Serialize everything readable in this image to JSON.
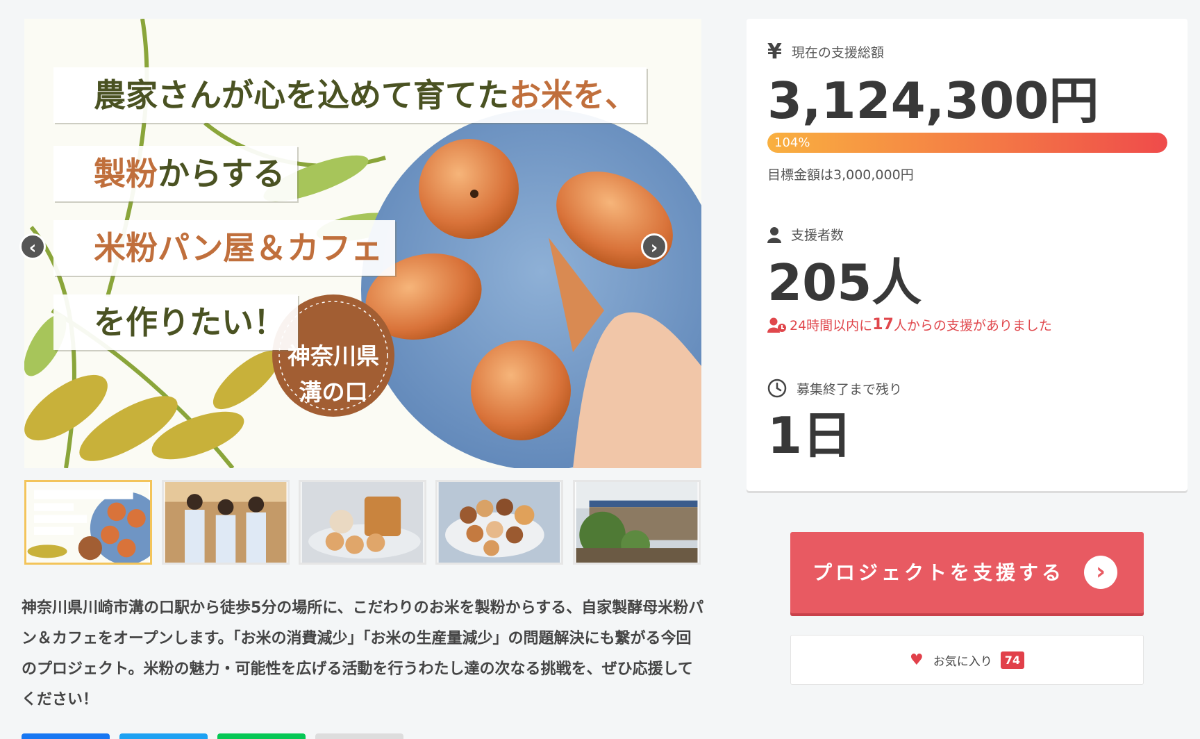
{
  "hero": {
    "line1_a": "農家さんが心を込めて育てた",
    "line1_b": "お米を、",
    "line2_a": "製粉",
    "line2_b": "からする",
    "line3": "米粉パン屋＆カフェ",
    "line4": "を作りたい！",
    "badge_line1": "神奈川県",
    "badge_line2": "溝の口",
    "prev_icon": "‹",
    "next_icon": "›"
  },
  "thumbnails": [
    {
      "name": "bread-plate-banner",
      "active": true
    },
    {
      "name": "staff-photo",
      "active": false
    },
    {
      "name": "bread-loaf-photo",
      "active": false
    },
    {
      "name": "assorted-breads-photo",
      "active": false
    },
    {
      "name": "cafe-exterior-photo",
      "active": false
    }
  ],
  "description": "神奈川県川崎市溝の口駅から徒歩5分の場所に、こだわりのお米を製粉からする、自家製酵母米粉パン＆カフェをオープンします。「お米の消費減少」「お米の生産量減少」の問題解決にも繋がる今回のプロジェクト。米粉の魅力・可能性を広げる活動を行うわたし達の次なる挑戦を、ぜひ応援してください！",
  "share_colors": [
    "#1877f2",
    "#1da1f2",
    "#06c755",
    "#dddddd"
  ],
  "stats": {
    "amount_icon": "¥",
    "amount_label": "現在の支援総額",
    "amount_value": "3,124,300円",
    "progress_text": "104%",
    "progress_percent": 100,
    "goal_text": "目標金額は3,000,000円",
    "backers_label": "支援者数",
    "backers_value": "205人",
    "recent_prefix": "24時間以内に",
    "recent_count": "17",
    "recent_suffix": "人からの支援がありました",
    "remaining_label": "募集終了まで残り",
    "remaining_value": "1日"
  },
  "actions": {
    "support_label": "プロジェクトを支援する",
    "support_icon": "›",
    "favorite_label": "お気に入り",
    "favorite_count": "74",
    "heart_icon": "♥"
  },
  "colors": {
    "accent": "#e85a62",
    "progress_start": "#f9b040",
    "progress_end": "#ef4b4b",
    "recent_text": "#e0474c"
  }
}
